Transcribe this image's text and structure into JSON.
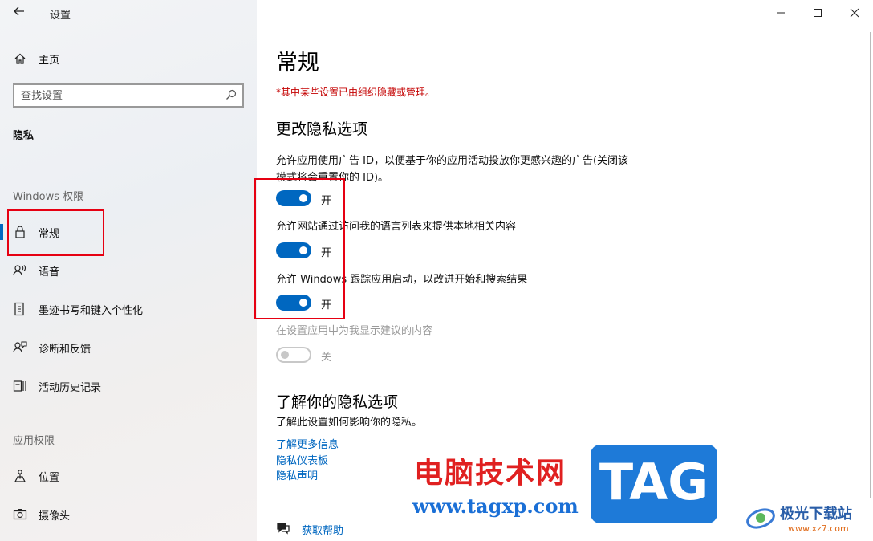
{
  "window": {
    "title": "设置",
    "minimize_label": "—",
    "maximize_label": "☐",
    "close_label": "✕"
  },
  "sidebar": {
    "home_label": "主页",
    "search_placeholder": "查找设置",
    "privacy_heading": "隐私",
    "windows_permissions_heading": "Windows 权限",
    "windows_items": [
      {
        "label": "常规",
        "icon": "lock-icon",
        "active": true
      },
      {
        "label": "语音",
        "icon": "speech-icon"
      },
      {
        "label": "墨迹书写和键入个性化",
        "icon": "ink-icon"
      },
      {
        "label": "诊断和反馈",
        "icon": "feedback-icon"
      },
      {
        "label": "活动历史记录",
        "icon": "history-icon"
      }
    ],
    "app_permissions_heading": "应用权限",
    "app_items": [
      {
        "label": "位置",
        "icon": "location-icon"
      },
      {
        "label": "摄像头",
        "icon": "camera-icon"
      }
    ]
  },
  "main": {
    "title": "常规",
    "managed_note": "*其中某些设置已由组织隐藏或管理。",
    "change_heading": "更改隐私选项",
    "settings": [
      {
        "description": "允许应用使用广告 ID，以便基于你的应用活动投放你更感兴趣的广告(关闭该模式将会重置你的 ID)。",
        "state": "开",
        "on": true
      },
      {
        "description": "允许网站通过访问我的语言列表来提供本地相关内容",
        "state": "开",
        "on": true
      },
      {
        "description": "允许 Windows 跟踪应用启动，以改进开始和搜索结果",
        "state": "开",
        "on": true
      },
      {
        "description": "在设置应用中为我显示建议的内容",
        "state": "关",
        "on": false,
        "disabled": true
      }
    ],
    "learn_heading": "了解你的隐私选项",
    "learn_desc": "了解此设置如何影响你的隐私。",
    "links": [
      "了解更多信息",
      "隐私仪表板",
      "隐私声明"
    ],
    "help_label": "获取帮助"
  },
  "watermark": {
    "site_name": "电脑技术网",
    "site_url": "www.tagxp.com",
    "tag_text": "TAG",
    "logo_name": "极光下载站",
    "logo_url": "www.xz7.com"
  },
  "colors": {
    "accent": "#0067c0",
    "highlight_box": "#e60012",
    "warning_text": "#c40000"
  }
}
